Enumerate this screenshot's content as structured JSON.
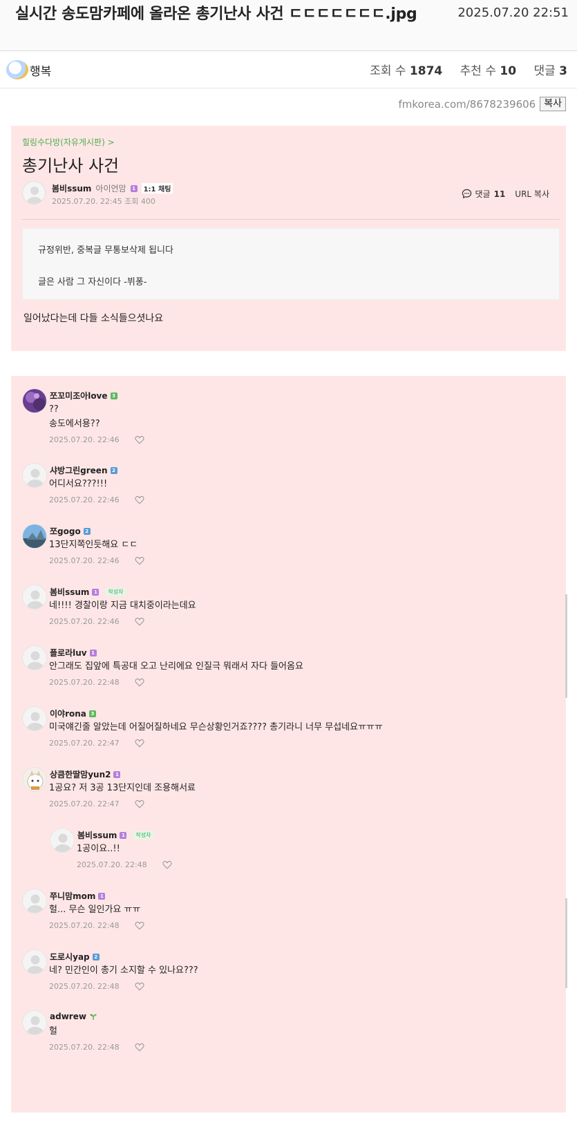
{
  "header": {
    "title": "실시간 송도맘카페에 올라온 총기난사 사건 ㄷㄷㄷㄷㄷㄷㄷ.jpg",
    "date": "2025.07.20 22:51"
  },
  "author_bar": {
    "author": "행복",
    "views_label": "조회 수",
    "views": "1874",
    "recommend_label": "추천 수",
    "recommend": "10",
    "comments_label": "댓글",
    "comments": "3"
  },
  "url_row": {
    "url": "fmkorea.com/8678239606",
    "copy_label": "복사"
  },
  "card": {
    "category": "힐링수다방(자유게시판) >",
    "title": "총기난사 사건",
    "writer": "봄비ssum",
    "writer_sub": "아이언맘",
    "writer_level": "1",
    "chat_label": "1:1 채팅",
    "meta": "2025.07.20. 22:45   조회 400",
    "comments_label": "댓글",
    "comments_count": "11",
    "url_copy_label": "URL 복사",
    "notice_line1": "규정위반, 중복글 무통보삭제 됩니다",
    "notice_line2": "글은 사람 그 자신이다 -뷔퐁-",
    "body": "일어났다는데 다들 소식들으셧나요"
  },
  "comments": [
    {
      "name": "쪼꼬미조아love",
      "level": "3",
      "level_color": "#5cb85c",
      "lines": [
        "??",
        "송도에서용??"
      ],
      "date": "2025.07.20. 22:46",
      "writer": false,
      "avatar": "purple"
    },
    {
      "name": "샤방그린green",
      "level": "2",
      "level_color": "#5b9bd5",
      "lines": [
        "어디서요???!!!"
      ],
      "date": "2025.07.20. 22:46",
      "writer": false,
      "avatar": "default"
    },
    {
      "name": "쪼gogo",
      "level": "2",
      "level_color": "#5b9bd5",
      "lines": [
        "13단지쪽인듯해요 ㄷㄷ"
      ],
      "date": "2025.07.20. 22:46",
      "writer": false,
      "avatar": "photo"
    },
    {
      "name": "봄비ssum",
      "level": "1",
      "level_color": "#b57edc",
      "lines": [
        "네!!!! 경찰이랑 지금 대치중이라는데요"
      ],
      "date": "2025.07.20. 22:46",
      "writer": true,
      "avatar": "default"
    },
    {
      "name": "플로라luv",
      "level": "1",
      "level_color": "#b57edc",
      "lines": [
        "안그래도 집앞에 특공대 오고 난리에요 인질극 뭐래서 자다 들어옴요"
      ],
      "date": "2025.07.20. 22:48",
      "writer": false,
      "avatar": "default"
    },
    {
      "name": "이야rona",
      "level": "3",
      "level_color": "#5cb85c",
      "lines": [
        "미국얘긴줄 알았는데 어질어질하네요 무슨상황인거죠???? 총기라니 너무 무섭네요ㅠㅠㅠ"
      ],
      "date": "2025.07.20. 22:47",
      "writer": false,
      "avatar": "default"
    },
    {
      "name": "상큼한딸맘yun2",
      "level": "1",
      "level_color": "#b57edc",
      "lines": [
        "1공요? 저 3공 13단지인데 조용해서료"
      ],
      "date": "2025.07.20. 22:47",
      "writer": false,
      "avatar": "cat"
    },
    {
      "name": "봄비ssum",
      "level": "1",
      "level_color": "#b57edc",
      "lines": [
        "1공이요..!!"
      ],
      "date": "2025.07.20. 22:48",
      "writer": true,
      "avatar": "default",
      "reply": true
    },
    {
      "name": "쭈니맘mom",
      "level": "1",
      "level_color": "#b57edc",
      "lines": [
        "헐... 무슨 일인가요 ㅠㅠ"
      ],
      "date": "2025.07.20. 22:48",
      "writer": false,
      "avatar": "default"
    },
    {
      "name": "도로시yap",
      "level": "2",
      "level_color": "#5b9bd5",
      "lines": [
        "네? 민간인이 총기 소지할 수 있나요???"
      ],
      "date": "2025.07.20. 22:48",
      "writer": false,
      "avatar": "default"
    },
    {
      "name": "adwrew",
      "level": "",
      "level_color": "",
      "lines": [
        "헐"
      ],
      "date": "2025.07.20. 22:48",
      "writer": false,
      "avatar": "default",
      "sprout": true
    }
  ],
  "writer_tag": "작성자",
  "colors": {
    "card_bg": "#ffe6e6",
    "category_green": "#4caf50",
    "level_purple": "#b57edc",
    "level_blue": "#5b9bd5",
    "level_green": "#5cb85c"
  }
}
